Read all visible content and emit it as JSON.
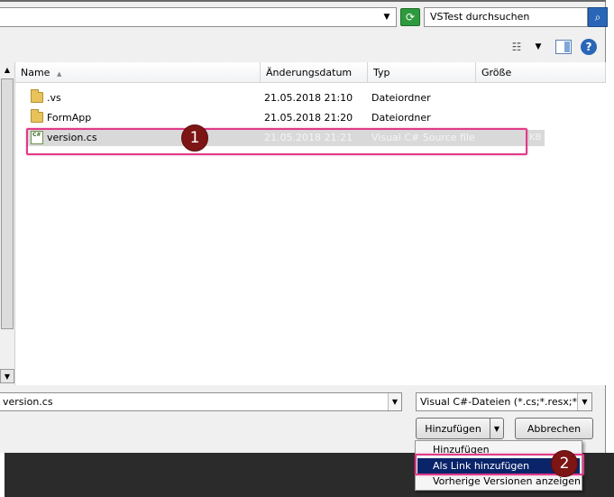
{
  "address_bar": {
    "search_placeholder": "VSTest durchsuchen"
  },
  "columns": [
    "Name",
    "Änderungsdatum",
    "Typ",
    "Größe"
  ],
  "files": [
    {
      "name": ".vs",
      "date": "21.05.2018 21:10",
      "type": "Dateiordner",
      "size": "",
      "icon": "folder-icon"
    },
    {
      "name": "FormApp",
      "date": "21.05.2018 21:20",
      "type": "Dateiordner",
      "size": "",
      "icon": "folder-icon"
    },
    {
      "name": "version.cs",
      "date": "21.05.2018 21:21",
      "type": "Visual C# Source file",
      "size": "1 KB",
      "icon": "csharp-file-icon",
      "selected": true
    }
  ],
  "cs_icon_text": "C#",
  "size_partial": "KB",
  "filename_value": "version.cs",
  "filter_value": "Visual C#-Dateien (*.cs;*.resx;*.res",
  "buttons": {
    "add": "Hinzufügen",
    "cancel": "Abbrechen"
  },
  "add_menu": [
    {
      "label": "Hinzufügen"
    },
    {
      "label": "Als Link hinzufügen",
      "active": true
    },
    {
      "label": "Vorherige Versionen anzeigen"
    }
  ],
  "annotations": [
    {
      "label": "1"
    },
    {
      "label": "2"
    }
  ],
  "colors": {
    "highlight": "#e03a88",
    "badge": "#7d1515",
    "menu_active": "#0a246a"
  }
}
